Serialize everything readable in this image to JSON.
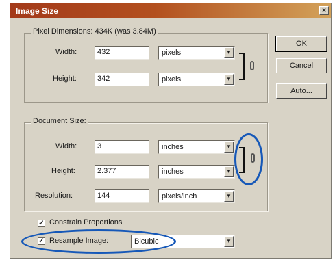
{
  "dialog": {
    "title": "Image Size",
    "close_glyph": "×"
  },
  "pixel_dimensions": {
    "legend": "Pixel Dimensions:",
    "summary": "434K (was 3.84M)",
    "width_label": "Width:",
    "width_value": "432",
    "width_unit": "pixels",
    "height_label": "Height:",
    "height_value": "342",
    "height_unit": "pixels"
  },
  "document_size": {
    "legend": "Document Size:",
    "width_label": "Width:",
    "width_value": "3",
    "width_unit": "inches",
    "height_label": "Height:",
    "height_value": "2.377",
    "height_unit": "inches",
    "resolution_label": "Resolution:",
    "resolution_value": "144",
    "resolution_unit": "pixels/inch"
  },
  "options": {
    "constrain_label": "Constrain Proportions",
    "constrain_checked": true,
    "resample_label": "Resample Image:",
    "resample_checked": true,
    "resample_method": "Bicubic",
    "check_glyph": "✓"
  },
  "buttons": {
    "ok": "OK",
    "cancel": "Cancel",
    "auto": "Auto..."
  },
  "icons": {
    "dropdown": "▼",
    "link": "chain-link-icon"
  },
  "annotation_color": "#1658b8"
}
